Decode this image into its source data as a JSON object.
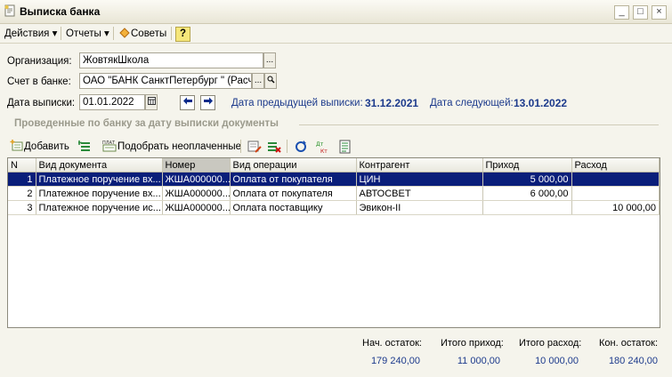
{
  "window": {
    "title": "Выписка банка"
  },
  "menu": {
    "actions": "Действия",
    "reports": "Отчеты",
    "advice": "Советы",
    "help": "?"
  },
  "form": {
    "org_label": "Организация:",
    "org_value": "ЖовтякШкола",
    "account_label": "Счет в банке:",
    "account_value": "ОАО \"БАНК СанктПетербург \" (Расче",
    "date_label": "Дата выписки:",
    "date_value": "01.01.2022",
    "prev_label": "Дата предыдущей выписки:",
    "prev_value": "31.12.2021",
    "next_label": "Дата следующей:",
    "next_value": "13.01.2022"
  },
  "group_title": "Проведенные по банку за дату выписки документы",
  "table_toolbar": {
    "add": "Добавить",
    "pick_unpaid": "Подобрать неоплаченные"
  },
  "table": {
    "columns": [
      "N",
      "Вид документа",
      "Номер",
      "Вид операции",
      "Контрагент",
      "Приход",
      "Расход"
    ],
    "rows": [
      {
        "n": "1",
        "doc": "Платежное поручение вх...",
        "num": "ЖША000000...",
        "op": "Оплата от покупателя",
        "party": "ЦИН",
        "income": "5 000,00",
        "expense": ""
      },
      {
        "n": "2",
        "doc": "Платежное поручение вх...",
        "num": "ЖША000000...",
        "op": "Оплата от покупателя",
        "party": "АВТОСВЕТ",
        "income": "6 000,00",
        "expense": ""
      },
      {
        "n": "3",
        "doc": "Платежное поручение ис...",
        "num": "ЖША000000...",
        "op": "Оплата поставщику",
        "party": "Эвикон-II",
        "income": "",
        "expense": "10 000,00"
      }
    ]
  },
  "totals": {
    "start_label": "Нач. остаток:",
    "start_value": "179 240,00",
    "income_label": "Итого приход:",
    "income_value": "11 000,00",
    "expense_label": "Итого расход:",
    "expense_value": "10 000,00",
    "end_label": "Кон. остаток:",
    "end_value": "180 240,00"
  }
}
